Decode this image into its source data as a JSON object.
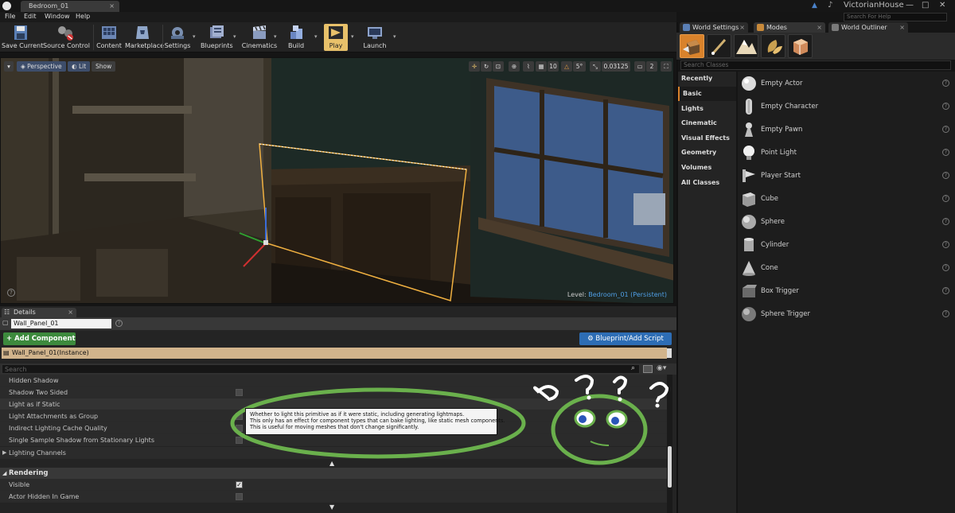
{
  "title_bar": {
    "document_tab": "Bedroom_01",
    "document_close": "×",
    "project_name": "VictorianHouse",
    "search_help_placeholder": "Search For Help",
    "minimize": "—",
    "maximize": "□",
    "close": "✕"
  },
  "menu": [
    "File",
    "Edit",
    "Window",
    "Help"
  ],
  "toolbar": {
    "save_current": "Save Current",
    "source_control": "Source Control",
    "content": "Content",
    "marketplace": "Marketplace",
    "settings": "Settings",
    "blueprints": "Blueprints",
    "cinematics": "Cinematics",
    "build": "Build",
    "play": "Play",
    "launch": "Launch"
  },
  "viewport": {
    "view_mode": "Perspective",
    "lighting": "Lit",
    "show": "Show",
    "angle": "5°",
    "scale": "0.03125",
    "camera_speed": "2",
    "level_label": "Level:",
    "level_name": "Bedroom_01 (Persistent)"
  },
  "details": {
    "tab": "Details",
    "tab_close": "×",
    "actor_name": "Wall_Panel_01",
    "add_component": "+ Add Component ▾",
    "blueprint_script": "Blueprint/Add Script",
    "instance": "Wall_Panel_01(Instance)",
    "search_placeholder": "Search",
    "properties": [
      {
        "label": "Hidden Shadow"
      },
      {
        "label": "Shadow Two Sided"
      },
      {
        "label": "Light as if Static"
      },
      {
        "label": "Light Attachments as Group"
      },
      {
        "label": "Indirect Lighting Cache Quality"
      },
      {
        "label": "Single Sample Shadow from Stationary Lights"
      },
      {
        "label": "Lighting Channels"
      }
    ],
    "rendering_section": "Rendering",
    "rendering_properties": [
      {
        "label": "Visible"
      },
      {
        "label": "Actor Hidden In Game"
      }
    ],
    "tooltip": [
      "Whether to light this primitive as if it were static, including generating lightmaps.",
      "This only has an effect for component types that can bake lighting, like static mesh components.",
      "This is useful for moving meshes that don't change significantly."
    ]
  },
  "right_panel": {
    "tabs": [
      "World Settings",
      "Modes",
      "World Outliner"
    ],
    "search_placeholder": "Search Classes",
    "categories": [
      "Recently Placed",
      "Basic",
      "Lights",
      "Cinematic",
      "Visual Effects",
      "Geometry",
      "Volumes",
      "All Classes"
    ],
    "selected_category": "Basic",
    "assets": [
      "Empty Actor",
      "Empty Character",
      "Empty Pawn",
      "Point Light",
      "Player Start",
      "Cube",
      "Sphere",
      "Cylinder",
      "Cone",
      "Box Trigger",
      "Sphere Trigger"
    ]
  },
  "colors": {
    "accent_orange": "#d9822b",
    "selection_yellow": "#f0b040",
    "add_component_green": "#3d8a3d",
    "blueprint_blue": "#2d6db5",
    "doodle_green": "#6ab04c"
  }
}
